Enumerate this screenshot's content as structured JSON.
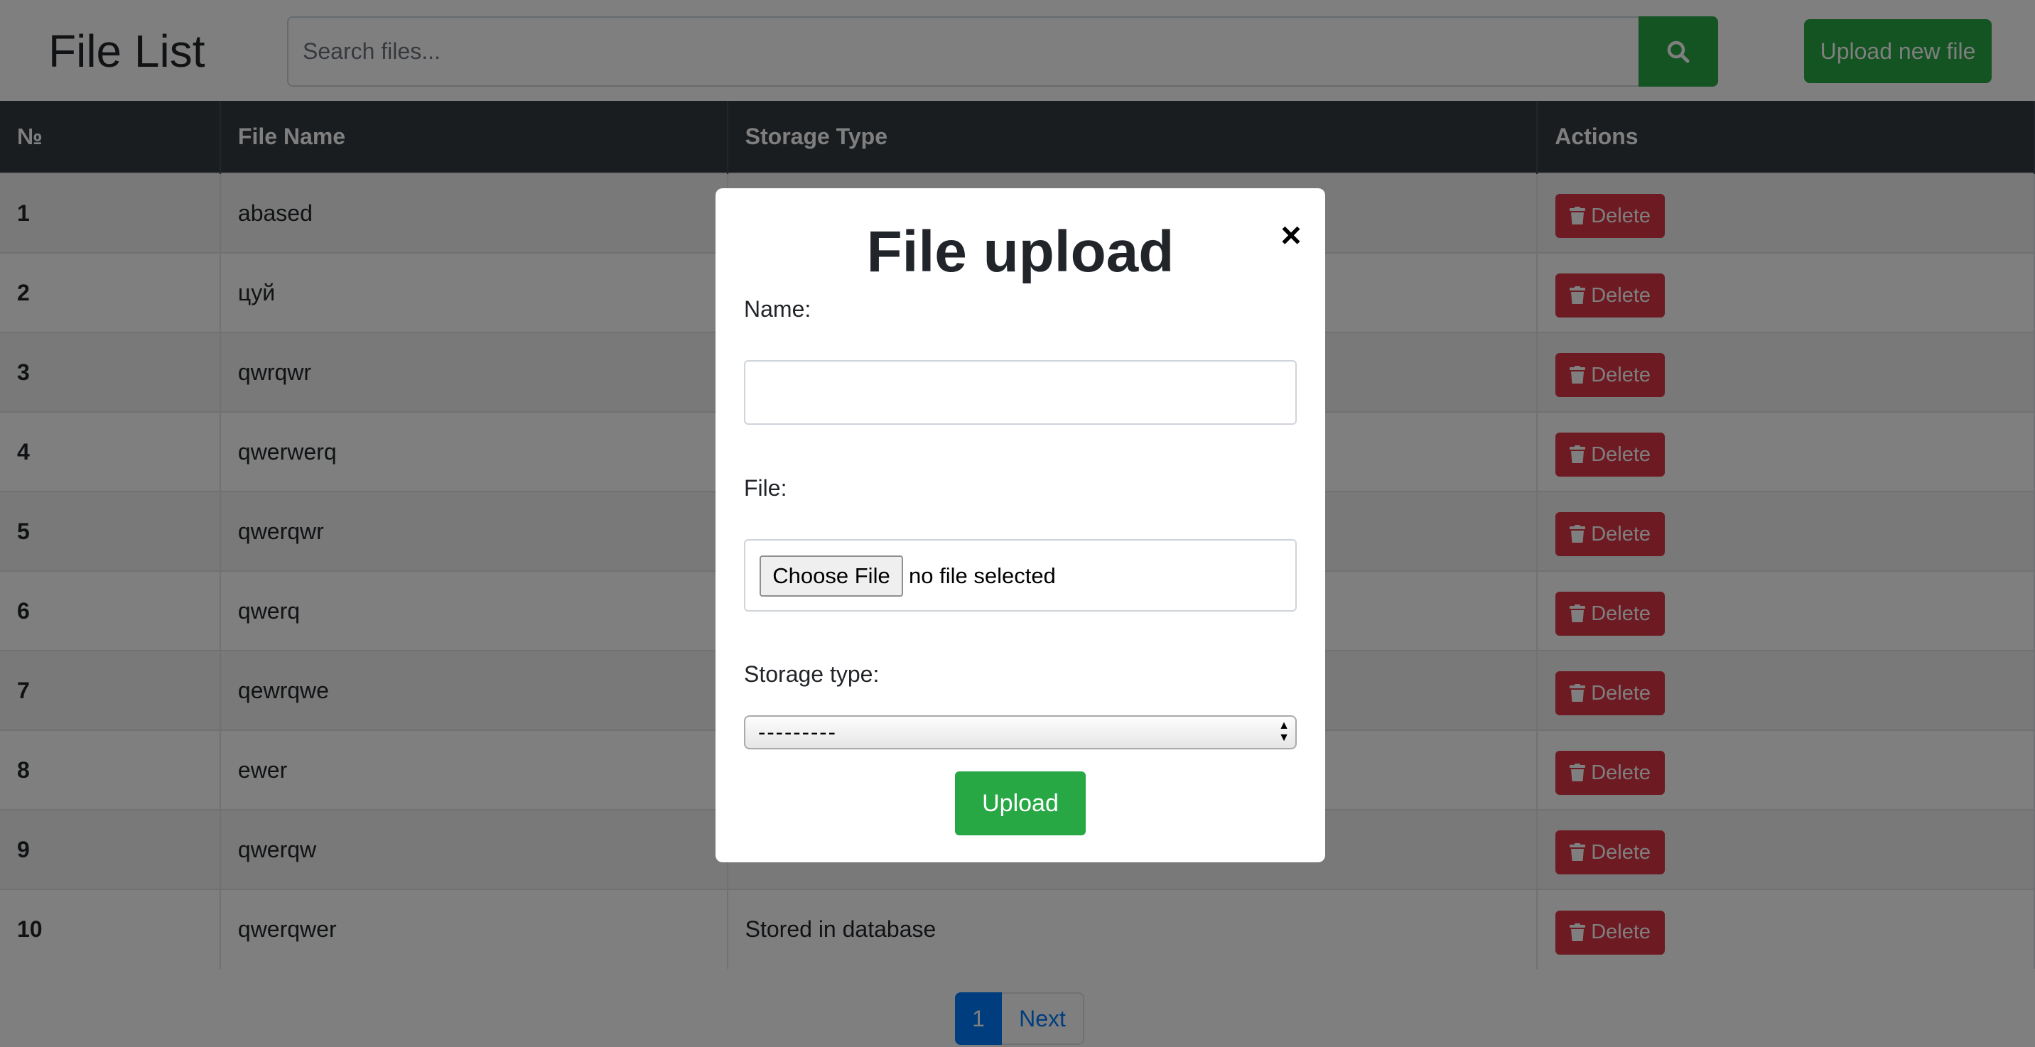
{
  "header": {
    "title": "File List",
    "search_placeholder": "Search files...",
    "search_icon": "search-icon",
    "upload_new_label": "Upload new file"
  },
  "table": {
    "columns": [
      "№",
      "File Name",
      "Storage Type",
      "Actions"
    ],
    "rows": [
      {
        "num": "1",
        "name": "abased",
        "storage": ""
      },
      {
        "num": "2",
        "name": "цуй",
        "storage": ""
      },
      {
        "num": "3",
        "name": "qwrqwr",
        "storage": ""
      },
      {
        "num": "4",
        "name": "qwerwerq",
        "storage": ""
      },
      {
        "num": "5",
        "name": "qwerqwr",
        "storage": ""
      },
      {
        "num": "6",
        "name": "qwerq",
        "storage": ""
      },
      {
        "num": "7",
        "name": "qewrqwe",
        "storage": ""
      },
      {
        "num": "8",
        "name": "ewer",
        "storage": ""
      },
      {
        "num": "9",
        "name": "qwerqw",
        "storage": ""
      },
      {
        "num": "10",
        "name": "qwerqwer",
        "storage": "Stored in database"
      }
    ],
    "delete_label": "Delete",
    "delete_icon": "trash-icon"
  },
  "pagination": {
    "current_page": "1",
    "next_label": "Next"
  },
  "modal": {
    "title": "File upload",
    "close_symbol": "×",
    "name_label": "Name:",
    "name_value": "",
    "file_label": "File:",
    "choose_file_label": "Choose File",
    "file_status": "no file selected",
    "storage_label": "Storage type:",
    "storage_selected": "---------",
    "upload_label": "Upload"
  },
  "colors": {
    "primary_green": "#28a745",
    "danger_red": "#dc3545",
    "header_dark": "#343a40",
    "link_blue": "#007bff",
    "backdrop": "rgba(0,0,0,0.5)"
  }
}
